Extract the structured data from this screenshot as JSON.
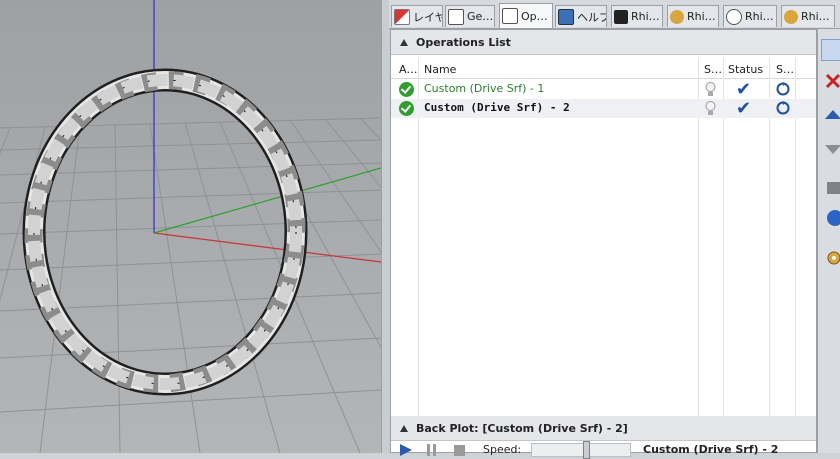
{
  "tabs": [
    {
      "label": "レイヤ",
      "icon": "layers-icon"
    },
    {
      "label": "Ge…",
      "icon": "document-icon"
    },
    {
      "label": "Op…",
      "icon": "document-icon"
    },
    {
      "label": "ヘルプ",
      "icon": "help-icon"
    },
    {
      "label": "Rhi…",
      "icon": "rhinogold-icon"
    },
    {
      "label": "Rhi…",
      "icon": "rhino-icon"
    },
    {
      "label": "Rhi…",
      "icon": "clock-icon"
    },
    {
      "label": "Rhi…",
      "icon": "rhino-icon"
    }
  ],
  "operations": {
    "title": "Operations List",
    "columns": {
      "active": "A…",
      "name": "Name",
      "shown": "S…",
      "status": "Status",
      "regen": "S…"
    },
    "rows": [
      {
        "name": "Custom (Drive Srf) - 1",
        "status": "✔",
        "selected": false
      },
      {
        "name": "Custom (Drive Srf) - 2",
        "status": "✔",
        "selected": true
      }
    ]
  },
  "backplot": {
    "title": "Back Plot: [Custom (Drive Srf) - 2]",
    "speed_label": "Speed:",
    "speed_level": 0.55,
    "current_op": "Custom (Drive Srf) - 2"
  },
  "right_toolbar": [
    "operations-icon",
    "delete-icon",
    "move-up-icon",
    "move-down-icon",
    "stock-icon",
    "nc-icon",
    "settings-icon"
  ],
  "colors": {
    "accent_green": "#2f9e2f",
    "status_blue": "#1c4fa8",
    "viewport_bg": "#a9abad"
  }
}
